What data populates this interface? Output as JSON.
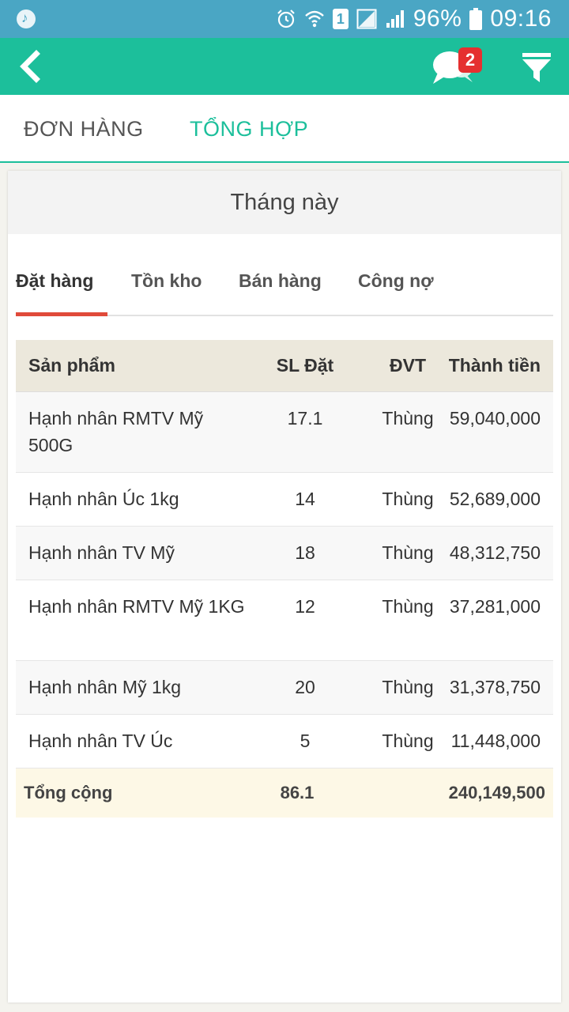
{
  "status_bar": {
    "battery": "96%",
    "time": "09:16",
    "sim_slot": "1"
  },
  "app_bar": {
    "notification_count": "2"
  },
  "main_tabs": [
    {
      "label": "ĐƠN HÀNG",
      "active": false
    },
    {
      "label": "TỔNG HỢP",
      "active": true
    }
  ],
  "period_label": "Tháng này",
  "sub_tabs": [
    {
      "label": "Đặt hàng",
      "active": true
    },
    {
      "label": "Tồn kho",
      "active": false
    },
    {
      "label": "Bán hàng",
      "active": false
    },
    {
      "label": "Công nợ",
      "active": false
    }
  ],
  "table": {
    "headers": {
      "product": "Sản phẩm",
      "qty": "SL Đặt",
      "unit": "ĐVT",
      "amount": "Thành tiền"
    },
    "rows": [
      {
        "product": "Hạnh nhân RMTV Mỹ 500G",
        "qty": "17.1",
        "unit": "Thùng",
        "amount": "59,040,000"
      },
      {
        "product": "Hạnh nhân Úc 1kg",
        "qty": "14",
        "unit": "Thùng",
        "amount": "52,689,000"
      },
      {
        "product": "Hạnh nhân TV Mỹ",
        "qty": "18",
        "unit": "Thùng",
        "amount": "48,312,750"
      },
      {
        "product": "Hạnh nhân RMTV Mỹ 1KG",
        "qty": "12",
        "unit": "Thùng",
        "amount": "37,281,000"
      },
      {
        "product": "Hạnh nhân Mỹ 1kg",
        "qty": "20",
        "unit": "Thùng",
        "amount": "31,378,750"
      },
      {
        "product": "Hạnh nhân TV Úc",
        "qty": "5",
        "unit": "Thùng",
        "amount": "11,448,000"
      }
    ],
    "total": {
      "label": "Tổng cộng",
      "qty": "86.1",
      "amount": "240,149,500"
    }
  },
  "colors": {
    "status_bar": "#4aa6c4",
    "app_bar": "#1cbf9b",
    "active_tab": "#1cbf9b",
    "sub_tab_indicator": "#e04a3a",
    "badge": "#e53030",
    "table_header": "#ece8dc",
    "total_row": "#fdf8e6"
  }
}
